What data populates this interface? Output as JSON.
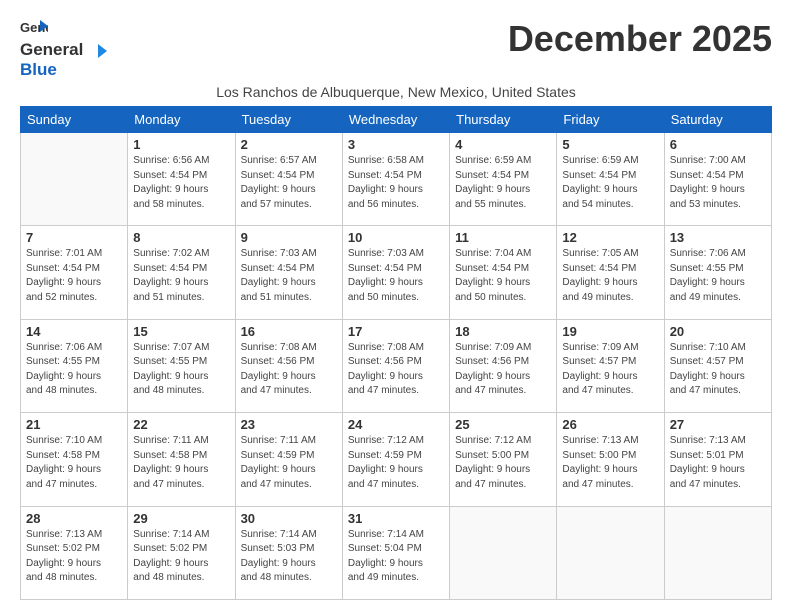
{
  "header": {
    "logo_general": "General",
    "logo_blue": "Blue",
    "month_title": "December 2025",
    "subtitle": "Los Ranchos de Albuquerque, New Mexico, United States"
  },
  "weekdays": [
    "Sunday",
    "Monday",
    "Tuesday",
    "Wednesday",
    "Thursday",
    "Friday",
    "Saturday"
  ],
  "weeks": [
    [
      {
        "day": "",
        "info": ""
      },
      {
        "day": "1",
        "info": "Sunrise: 6:56 AM\nSunset: 4:54 PM\nDaylight: 9 hours\nand 58 minutes."
      },
      {
        "day": "2",
        "info": "Sunrise: 6:57 AM\nSunset: 4:54 PM\nDaylight: 9 hours\nand 57 minutes."
      },
      {
        "day": "3",
        "info": "Sunrise: 6:58 AM\nSunset: 4:54 PM\nDaylight: 9 hours\nand 56 minutes."
      },
      {
        "day": "4",
        "info": "Sunrise: 6:59 AM\nSunset: 4:54 PM\nDaylight: 9 hours\nand 55 minutes."
      },
      {
        "day": "5",
        "info": "Sunrise: 6:59 AM\nSunset: 4:54 PM\nDaylight: 9 hours\nand 54 minutes."
      },
      {
        "day": "6",
        "info": "Sunrise: 7:00 AM\nSunset: 4:54 PM\nDaylight: 9 hours\nand 53 minutes."
      }
    ],
    [
      {
        "day": "7",
        "info": "Sunrise: 7:01 AM\nSunset: 4:54 PM\nDaylight: 9 hours\nand 52 minutes."
      },
      {
        "day": "8",
        "info": "Sunrise: 7:02 AM\nSunset: 4:54 PM\nDaylight: 9 hours\nand 51 minutes."
      },
      {
        "day": "9",
        "info": "Sunrise: 7:03 AM\nSunset: 4:54 PM\nDaylight: 9 hours\nand 51 minutes."
      },
      {
        "day": "10",
        "info": "Sunrise: 7:03 AM\nSunset: 4:54 PM\nDaylight: 9 hours\nand 50 minutes."
      },
      {
        "day": "11",
        "info": "Sunrise: 7:04 AM\nSunset: 4:54 PM\nDaylight: 9 hours\nand 50 minutes."
      },
      {
        "day": "12",
        "info": "Sunrise: 7:05 AM\nSunset: 4:54 PM\nDaylight: 9 hours\nand 49 minutes."
      },
      {
        "day": "13",
        "info": "Sunrise: 7:06 AM\nSunset: 4:55 PM\nDaylight: 9 hours\nand 49 minutes."
      }
    ],
    [
      {
        "day": "14",
        "info": "Sunrise: 7:06 AM\nSunset: 4:55 PM\nDaylight: 9 hours\nand 48 minutes."
      },
      {
        "day": "15",
        "info": "Sunrise: 7:07 AM\nSunset: 4:55 PM\nDaylight: 9 hours\nand 48 minutes."
      },
      {
        "day": "16",
        "info": "Sunrise: 7:08 AM\nSunset: 4:56 PM\nDaylight: 9 hours\nand 47 minutes."
      },
      {
        "day": "17",
        "info": "Sunrise: 7:08 AM\nSunset: 4:56 PM\nDaylight: 9 hours\nand 47 minutes."
      },
      {
        "day": "18",
        "info": "Sunrise: 7:09 AM\nSunset: 4:56 PM\nDaylight: 9 hours\nand 47 minutes."
      },
      {
        "day": "19",
        "info": "Sunrise: 7:09 AM\nSunset: 4:57 PM\nDaylight: 9 hours\nand 47 minutes."
      },
      {
        "day": "20",
        "info": "Sunrise: 7:10 AM\nSunset: 4:57 PM\nDaylight: 9 hours\nand 47 minutes."
      }
    ],
    [
      {
        "day": "21",
        "info": "Sunrise: 7:10 AM\nSunset: 4:58 PM\nDaylight: 9 hours\nand 47 minutes."
      },
      {
        "day": "22",
        "info": "Sunrise: 7:11 AM\nSunset: 4:58 PM\nDaylight: 9 hours\nand 47 minutes."
      },
      {
        "day": "23",
        "info": "Sunrise: 7:11 AM\nSunset: 4:59 PM\nDaylight: 9 hours\nand 47 minutes."
      },
      {
        "day": "24",
        "info": "Sunrise: 7:12 AM\nSunset: 4:59 PM\nDaylight: 9 hours\nand 47 minutes."
      },
      {
        "day": "25",
        "info": "Sunrise: 7:12 AM\nSunset: 5:00 PM\nDaylight: 9 hours\nand 47 minutes."
      },
      {
        "day": "26",
        "info": "Sunrise: 7:13 AM\nSunset: 5:00 PM\nDaylight: 9 hours\nand 47 minutes."
      },
      {
        "day": "27",
        "info": "Sunrise: 7:13 AM\nSunset: 5:01 PM\nDaylight: 9 hours\nand 47 minutes."
      }
    ],
    [
      {
        "day": "28",
        "info": "Sunrise: 7:13 AM\nSunset: 5:02 PM\nDaylight: 9 hours\nand 48 minutes."
      },
      {
        "day": "29",
        "info": "Sunrise: 7:14 AM\nSunset: 5:02 PM\nDaylight: 9 hours\nand 48 minutes."
      },
      {
        "day": "30",
        "info": "Sunrise: 7:14 AM\nSunset: 5:03 PM\nDaylight: 9 hours\nand 48 minutes."
      },
      {
        "day": "31",
        "info": "Sunrise: 7:14 AM\nSunset: 5:04 PM\nDaylight: 9 hours\nand 49 minutes."
      },
      {
        "day": "",
        "info": ""
      },
      {
        "day": "",
        "info": ""
      },
      {
        "day": "",
        "info": ""
      }
    ]
  ]
}
